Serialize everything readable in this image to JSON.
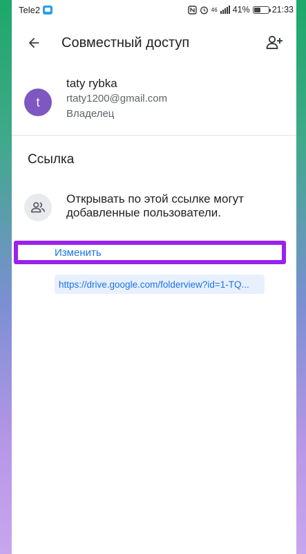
{
  "status_bar": {
    "carrier": "Tele2",
    "signal": "46",
    "battery": "41%",
    "battery_level": 0.41,
    "time": "21:33"
  },
  "app_bar": {
    "title": "Совместный доступ",
    "back_icon": "arrow-back-icon",
    "add_person_icon": "person-add-icon"
  },
  "owner": {
    "avatar_letter": "t",
    "avatar_color": "#7e57c2",
    "name": "taty rybka",
    "email": "rtaty1200@gmail.com",
    "role": "Владелец"
  },
  "link_section": {
    "title": "Ссылка",
    "icon": "people-icon",
    "description": "Открывать по этой ссылке могут добавленные пользователи.",
    "change_label": "Изменить",
    "url": "https://drive.google.com/folderview?id=1-TQ..."
  },
  "colors": {
    "highlight": "#9a21ee",
    "link": "#1a73e8"
  }
}
